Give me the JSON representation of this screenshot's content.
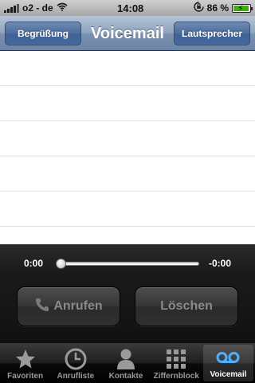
{
  "status_bar": {
    "carrier": "o2 - de",
    "time": "14:08",
    "battery": "86 %",
    "icons": [
      "signal-icon",
      "wifi-icon",
      "rotation-lock-icon",
      "battery-charging-icon"
    ]
  },
  "nav": {
    "title": "Voicemail",
    "left_button": "Begrüßung",
    "right_button": "Lautsprecher"
  },
  "player": {
    "elapsed": "0:00",
    "remaining": "-0:00",
    "progress": 0.0,
    "call_label": "Anrufen",
    "delete_label": "Löschen"
  },
  "tabs": [
    {
      "label": "Favoriten",
      "icon": "star-icon",
      "active": false
    },
    {
      "label": "Anrufliste",
      "icon": "clock-icon",
      "active": false
    },
    {
      "label": "Kontakte",
      "icon": "person-icon",
      "active": false
    },
    {
      "label": "Ziffernblock",
      "icon": "keypad-icon",
      "active": false
    },
    {
      "label": "Voicemail",
      "icon": "voicemail-icon",
      "active": true
    }
  ],
  "colors": {
    "nav_blue": "#6c84a6",
    "active_tab_icon": "#4fb0ff"
  }
}
